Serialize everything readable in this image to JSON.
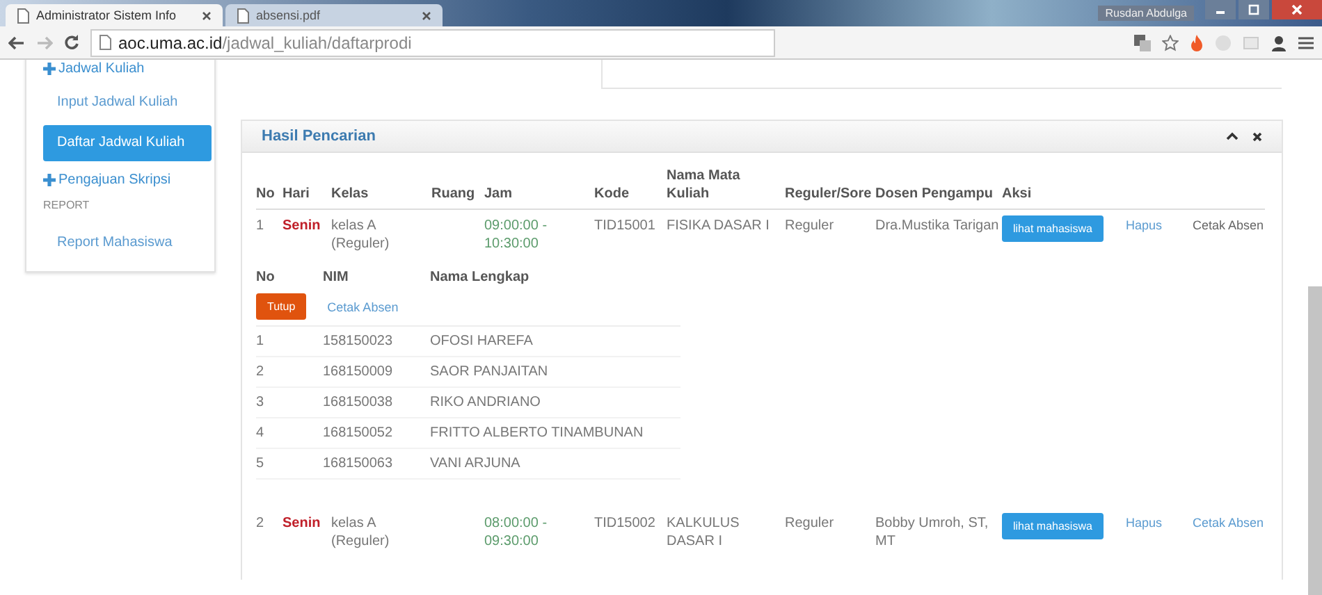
{
  "browser": {
    "tabs": [
      {
        "title": "Administrator Sistem Info",
        "selected": true
      },
      {
        "title": "absensi.pdf",
        "selected": false
      }
    ],
    "user": "Rusdan Abdulga",
    "url_host": "aoc.uma.ac.id",
    "url_path": "/jadwal_kuliah/daftarprodi"
  },
  "sidebar": {
    "items": [
      {
        "kind": "group",
        "label": "Jadwal Kuliah"
      },
      {
        "kind": "link",
        "label": "Input Jadwal Kuliah",
        "selected": false
      },
      {
        "kind": "link",
        "label": "Daftar Jadwal Kuliah",
        "selected": true
      },
      {
        "kind": "group",
        "label": "Pengajuan Skripsi"
      },
      {
        "kind": "header",
        "label": "REPORT"
      },
      {
        "kind": "link",
        "label": "Report Mahasiswa",
        "selected": false
      }
    ]
  },
  "panel": {
    "title": "Hasil Pencarian",
    "columns": [
      "No",
      "Hari",
      "Kelas",
      "Ruang",
      "Jam",
      "Kode",
      "Nama Mata Kuliah",
      "Reguler/Sore",
      "Dosen Pengampu",
      "Aksi"
    ],
    "rows": [
      {
        "no": "1",
        "hari": "Senin",
        "kelas": "kelas A (Reguler)",
        "jam": "09:00:00 - 10:30:00",
        "kode": "TID15001",
        "mata_kuliah": "FISIKA DASAR I",
        "reguler_sore": "Reguler",
        "dosen": "Dra.Mustika Tarigan",
        "actions": [
          "lihat mahasiswa",
          "Hapus",
          "Cetak Absen"
        ],
        "students": {
          "columns": [
            "No",
            "NIM",
            "Nama Lengkap"
          ],
          "close_button": "Tutup",
          "print_link": "Cetak Absen",
          "rows": [
            {
              "no": "1",
              "nim": "158150023",
              "nama": "OFOSI HAREFA"
            },
            {
              "no": "2",
              "nim": "168150009",
              "nama": "SAOR PANJAITAN"
            },
            {
              "no": "3",
              "nim": "168150038",
              "nama": "RIKO ANDRIANO"
            },
            {
              "no": "4",
              "nim": "168150052",
              "nama": "FRITTO ALBERTO TINAMBUNAN"
            },
            {
              "no": "5",
              "nim": "168150063",
              "nama": "VANI ARJUNA"
            }
          ]
        }
      },
      {
        "no": "2",
        "hari": "Senin",
        "kelas": "kelas A (Reguler)",
        "jam": "08:00:00 - 09:30:00",
        "kode": "TID15002",
        "mata_kuliah": "KALKULUS DASAR I",
        "reguler_sore": "Reguler",
        "dosen": "Bobby Umroh, ST, MT",
        "actions": [
          "lihat mahasiswa",
          "Hapus",
          "Cetak Absen"
        ]
      }
    ]
  }
}
